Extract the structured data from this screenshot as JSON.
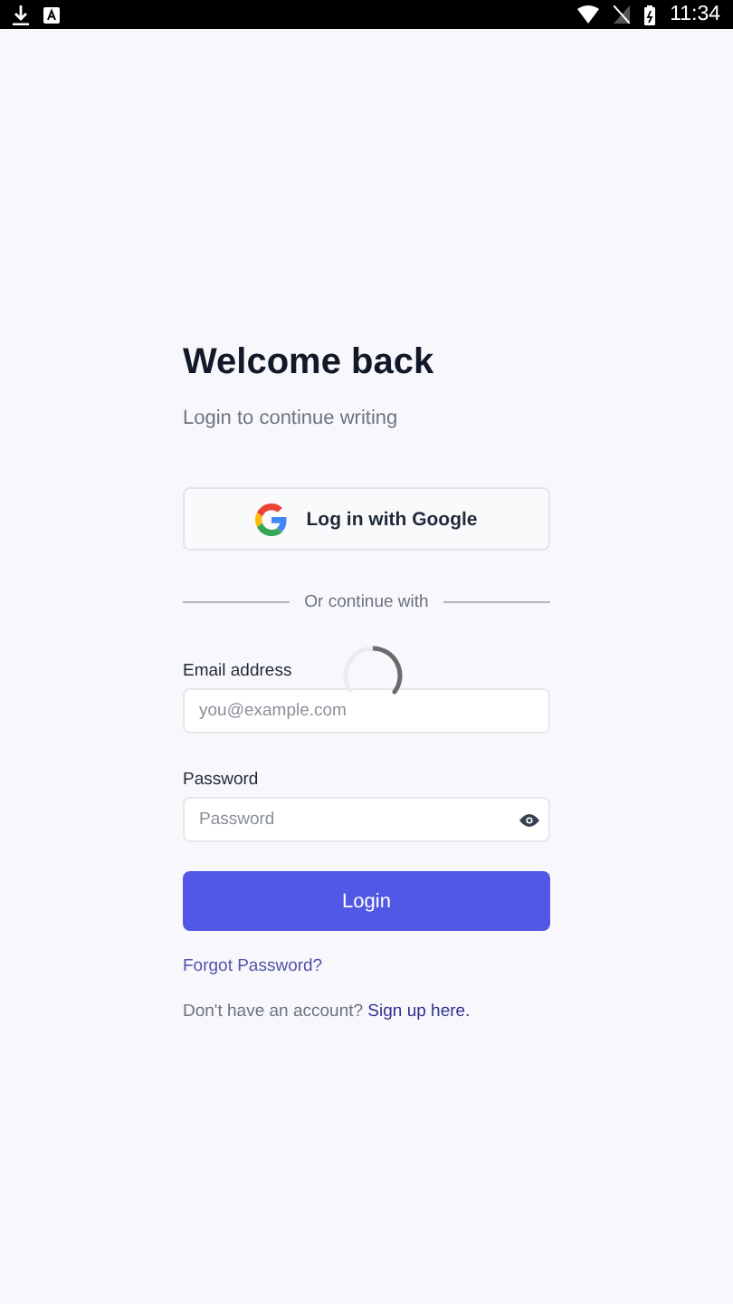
{
  "status_bar": {
    "time": "11:34"
  },
  "title": "Welcome back",
  "subtitle": "Login to continue writing",
  "google_button": {
    "label": "Log in with Google"
  },
  "divider": {
    "label": "Or continue with"
  },
  "email": {
    "label": "Email address",
    "placeholder": "you@example.com"
  },
  "password": {
    "label": "Password",
    "placeholder": "Password"
  },
  "login_button": {
    "label": "Login"
  },
  "forgot_link": "Forgot Password?",
  "signup": {
    "text": "Don't have an account?",
    "link": "Sign up here."
  },
  "loading": true
}
